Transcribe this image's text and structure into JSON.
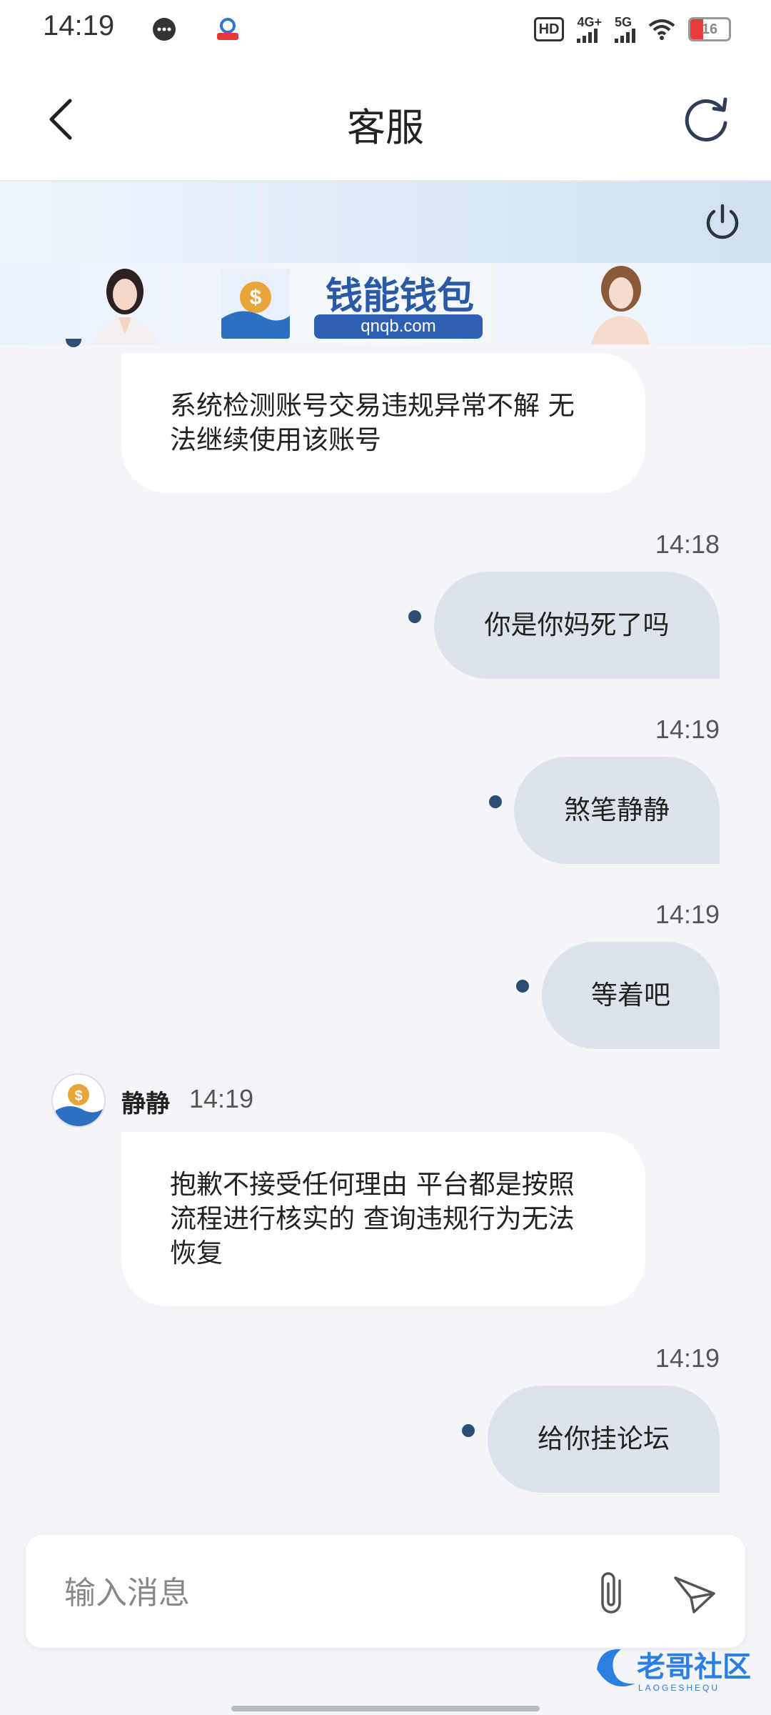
{
  "status_bar": {
    "time": "14:19",
    "hd_label": "HD",
    "sim1_label": "4G+",
    "sim2_label": "5G",
    "battery": "16"
  },
  "header": {
    "title": "客服"
  },
  "banner": {
    "brand_name": "钱能钱包",
    "url": "qnqb.com",
    "logo_caption": "钱能钱包"
  },
  "messages": [
    {
      "from": "agent",
      "text": "系统检测账号交易违规异常不解 无法继续使用该账号"
    },
    {
      "from": "user",
      "time": "14:18",
      "text": "你是你妈死了吗"
    },
    {
      "from": "user",
      "time": "14:19",
      "text": "煞笔静静"
    },
    {
      "from": "user",
      "time": "14:19",
      "text": "等着吧"
    },
    {
      "from": "agent",
      "name": "静静",
      "time": "14:19",
      "text": "抱歉不接受任何理由 平台都是按照流程进行核实的 查询违规行为无法恢复"
    },
    {
      "from": "user",
      "time": "14:19",
      "text": "给你挂论坛"
    }
  ],
  "composer": {
    "placeholder": "输入消息"
  },
  "watermark": {
    "text": "老哥社区",
    "subtext": "LAOGESHEQU"
  },
  "colors": {
    "outgoing_bubble": "#dde3ea",
    "incoming_bubble": "#ffffff",
    "background": "#f3f5f9",
    "status_dot": "#2b4f73"
  }
}
